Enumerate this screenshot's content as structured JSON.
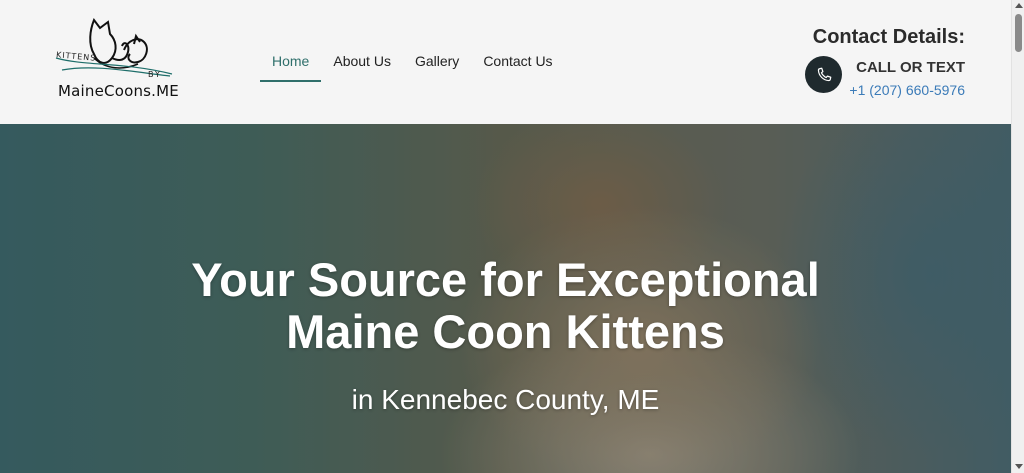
{
  "logo": {
    "kittens_text": "KITTENS",
    "by_text": "BY",
    "name_text": "MaineCoons.ME"
  },
  "nav": {
    "items": [
      {
        "label": "Home",
        "active": true
      },
      {
        "label": "About Us",
        "active": false
      },
      {
        "label": "Gallery",
        "active": false
      },
      {
        "label": "Contact Us",
        "active": false
      }
    ]
  },
  "contact": {
    "title": "Contact Details:",
    "call_label": "CALL OR TEXT",
    "phone": "+1 (207) 660-5976",
    "icon": "phone-icon"
  },
  "hero": {
    "title_line1": "Your Source for Exceptional",
    "title_line2": "Maine Coon Kittens",
    "subtitle": "in Kennebec County, ME"
  },
  "colors": {
    "accent": "#2f6f6b",
    "link": "#3b7bb8",
    "dark": "#1f2a2e"
  }
}
